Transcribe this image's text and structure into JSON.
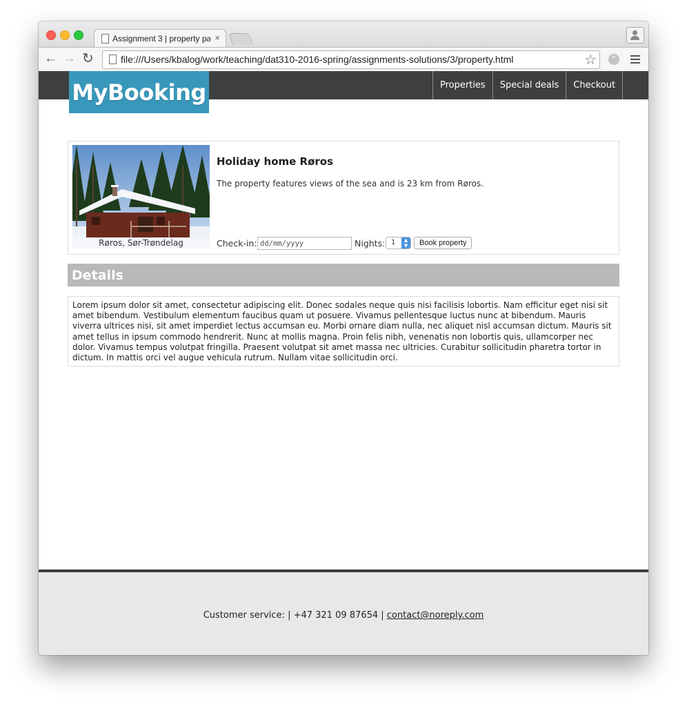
{
  "browser": {
    "tab_title": "Assignment 3 | property pa",
    "tab_close": "×",
    "url": "file:///Users/kbalog/work/teaching/dat310-2016-spring/assignments-solutions/3/property.html"
  },
  "site": {
    "logo": "MyBooking",
    "nav": [
      "Properties",
      "Special deals",
      "Checkout"
    ]
  },
  "property": {
    "title": "Holiday home Røros",
    "description": "The property features views of the sea and is 23 km from Røros.",
    "image_caption": "Røros, Sør-Trøndelag",
    "checkin_label": "Check-in:",
    "checkin_placeholder": "dd/mm/yyyy",
    "nights_label": "Nights:",
    "nights_value": "1",
    "book_button": "Book property"
  },
  "details": {
    "heading": "Details",
    "text": "Lorem ipsum dolor sit amet, consectetur adipiscing elit. Donec sodales neque quis nisi facilisis lobortis. Nam efficitur eget nisi sit amet bibendum. Vestibulum elementum faucibus quam ut posuere. Vivamus pellentesque luctus nunc at bibendum. Mauris viverra ultrices nisi, sit amet imperdiet lectus accumsan eu. Morbi ornare diam nulla, nec aliquet nisl accumsan dictum. Mauris sit amet tellus in ipsum commodo hendrerit. Nunc at mollis magna. Proin felis nibh, venenatis non lobortis quis, ullamcorper nec dolor. Vivamus tempus volutpat fringilla. Praesent volutpat sit amet massa nec ultricies. Curabitur sollicitudin pharetra tortor in dictum. In mattis orci vel augue vehicula rutrum. Nullam vitae sollicitudin orci."
  },
  "footer": {
    "prefix": "Customer service: | +47 321 09 87654 | ",
    "email": "contact@noreply.com"
  },
  "colors": {
    "header_bg": "#3f3f3f",
    "logo_bg": "#3898bb",
    "details_bar": "#b9b9b9",
    "footer_bg": "#e8e8e8"
  }
}
